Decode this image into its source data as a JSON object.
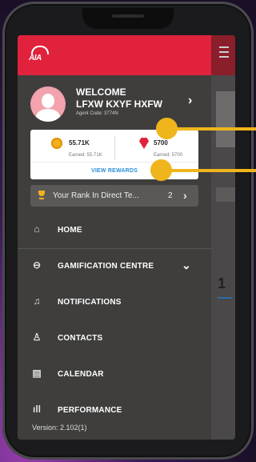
{
  "profile": {
    "welcome": "WELCOME",
    "name": "LFXW KXYF HXFW",
    "agent_code": "Agent Code: 3774N"
  },
  "stats": {
    "points_value": "55.71K",
    "points_sub": "Earned: 55.71K",
    "gems_value": "5700",
    "gems_sub": "Earned: 5700",
    "view_rewards": "VIEW REWARDS"
  },
  "rank": {
    "text": "Your Rank In Direct Te...",
    "value": "2"
  },
  "menu": {
    "items": [
      {
        "label": "HOME",
        "icon": "home-icon"
      },
      {
        "label": "GAMIFICATION CENTRE",
        "icon": "gamepad-icon"
      },
      {
        "label": "NOTIFICATIONS",
        "icon": "bell-icon"
      },
      {
        "label": "CONTACTS",
        "icon": "contact-icon"
      },
      {
        "label": "CALENDAR",
        "icon": "calendar-icon"
      },
      {
        "label": "PERFORMANCE",
        "icon": "bar-chart-icon"
      }
    ]
  },
  "version": "Version: 2.102(1)",
  "background": {
    "digit": "1"
  },
  "colors": {
    "brand_red": "#e0223c",
    "accent_blue": "#2a8fd6",
    "annotation_yellow": "#f0b51c"
  }
}
